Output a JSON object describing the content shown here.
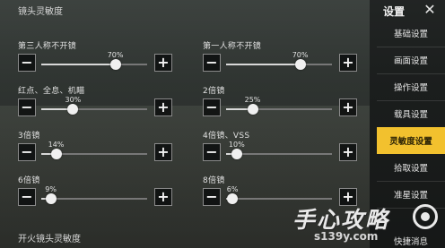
{
  "section_title": "镜头灵敏度",
  "footer_section_title": "开火镜头灵敏度",
  "sliders": [
    {
      "label": "第三人称不开镜",
      "value": 0.7,
      "value_text": "70%"
    },
    {
      "label": "第一人称不开镜",
      "value": 0.7,
      "value_text": "70%"
    },
    {
      "label": "红点、全息、机瞄",
      "value": 0.3,
      "value_text": "30%"
    },
    {
      "label": "2倍镜",
      "value": 0.25,
      "value_text": "25%"
    },
    {
      "label": "3倍镜",
      "value": 0.14,
      "value_text": "14%"
    },
    {
      "label": "4倍镜、VSS",
      "value": 0.1,
      "value_text": "10%"
    },
    {
      "label": "6倍镜",
      "value": 0.09,
      "value_text": "9%"
    },
    {
      "label": "8倍镜",
      "value": 0.06,
      "value_text": "6%"
    }
  ],
  "minus_symbol": "−",
  "plus_symbol": "+",
  "sidebar": {
    "title": "设置",
    "close_symbol": "✕",
    "items": [
      {
        "label": "基础设置",
        "active": false
      },
      {
        "label": "画面设置",
        "active": false
      },
      {
        "label": "操作设置",
        "active": false
      },
      {
        "label": "载具设置",
        "active": false
      },
      {
        "label": "灵敏度设置",
        "active": true
      },
      {
        "label": "拾取设置",
        "active": false
      },
      {
        "label": "准星设置",
        "active": false
      }
    ],
    "partial_item_label": "快捷消息"
  },
  "watermark": {
    "text": "手心攻略",
    "site": "s139y.com"
  },
  "colors": {
    "accent": "#f2c12e"
  }
}
